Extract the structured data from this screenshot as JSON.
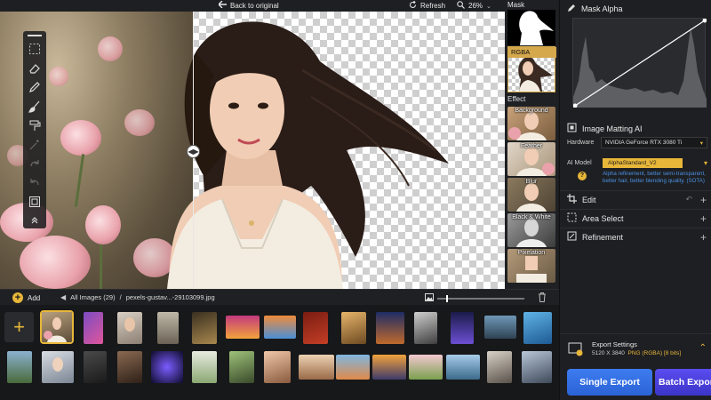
{
  "topbar": {
    "back_label": "Back to original",
    "refresh_label": "Refresh",
    "zoom_value": "26%"
  },
  "strip": {
    "mask_label": "Mask",
    "rgba_label": "RGBA",
    "effect_label": "Effect",
    "effects": [
      "Background",
      "Feather",
      "Blur",
      "Black & White",
      "Pixelation"
    ]
  },
  "panel": {
    "mask_alpha_title": "Mask Alpha",
    "matting_title": "Image Matting AI",
    "hardware_label": "Hardware",
    "hardware_value": "NVIDIA GeForce RTX 3080 Ti",
    "model_label": "AI Model",
    "model_value": "AlphaStandard_V2",
    "model_description": "Alpha refinement, better semi-transparent, better hair, better blending quality. (SOTA)",
    "sections": {
      "edit": "Edit",
      "area_select": "Area Select",
      "refinement": "Refinement"
    },
    "export_title": "Export Settings",
    "export_size": "5120 X 3840",
    "export_format": "PNG (RGBA) [8 bits]",
    "single_export": "Single Export",
    "batch_export": "Batch Export"
  },
  "gallery": {
    "add_label": "Add",
    "folder_label": "All Images (29)",
    "separator": "/",
    "file_label": "pexels-gustav...-29103099.jpg"
  },
  "colors": {
    "accent": "#e8b73a",
    "export_blue": "#3d7cf0",
    "batch_purple": "#5a4df0",
    "link_blue": "#4a90e2"
  }
}
